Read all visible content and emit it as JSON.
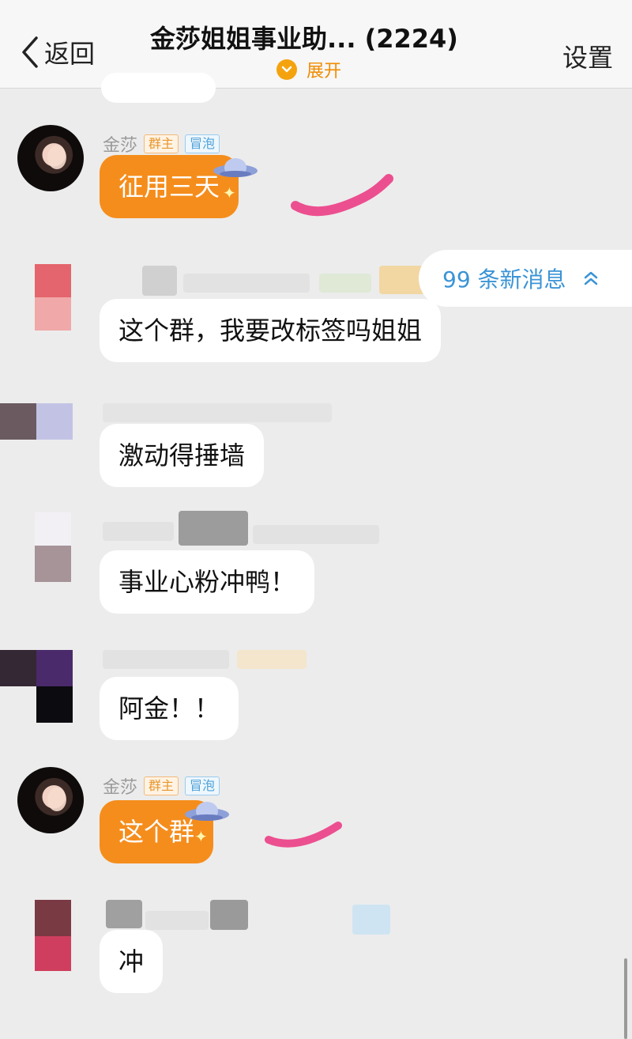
{
  "header": {
    "back_label": "返回",
    "title": "金莎姐姐事业助... (2224)",
    "expand_label": "展开",
    "settings_label": "设置"
  },
  "new_messages": {
    "label": "99 条新消息",
    "icon": "double-chevron-up-icon"
  },
  "messages": [
    {
      "sender": "金莎",
      "badges": [
        "群主",
        "冒泡"
      ],
      "text": "征用三天",
      "style": "orange"
    },
    {
      "sender": "",
      "text": "这个群，我要改标签吗姐姐",
      "style": "white"
    },
    {
      "sender": "",
      "text": "激动得捶墙",
      "style": "white"
    },
    {
      "sender": "",
      "text": "事业心粉冲鸭！",
      "style": "white"
    },
    {
      "sender": "",
      "text": "阿金！！",
      "style": "white"
    },
    {
      "sender": "金莎",
      "badges": [
        "群主",
        "冒泡"
      ],
      "text": "这个群",
      "style": "orange"
    },
    {
      "sender": "",
      "text": "冲",
      "style": "white"
    }
  ],
  "colors": {
    "background": "#ececec",
    "accent_orange": "#f58d1c",
    "link_blue": "#3b94d6",
    "scribble_pink": "#ec4f8f"
  }
}
